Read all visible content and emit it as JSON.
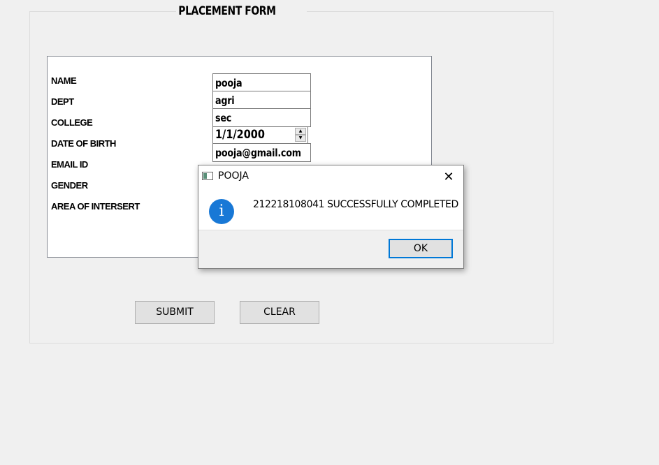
{
  "form": {
    "title": "PLACEMENT FORM",
    "labels": {
      "name": "NAME",
      "dept": "DEPT",
      "college": "COLLEGE",
      "dob": "DATE OF BIRTH",
      "email": "EMAIL ID",
      "gender": "GENDER",
      "interest": "AREA OF INTERSERT"
    },
    "values": {
      "name": "pooja",
      "dept": "agri",
      "college": "sec",
      "dob": "1/1/2000",
      "email": "pooja@gmail.com"
    },
    "buttons": {
      "submit": "SUBMIT",
      "clear": "CLEAR"
    }
  },
  "dialog": {
    "title": "POOJA",
    "close_glyph": "✕",
    "icon": "info-icon",
    "icon_glyph": "i",
    "message": "212218108041 SUCCESSFULLY COMPLETED",
    "ok_label": "OK"
  },
  "colors": {
    "background": "#f0f0f0",
    "accent": "#0078d7",
    "info": "#1878d6"
  }
}
